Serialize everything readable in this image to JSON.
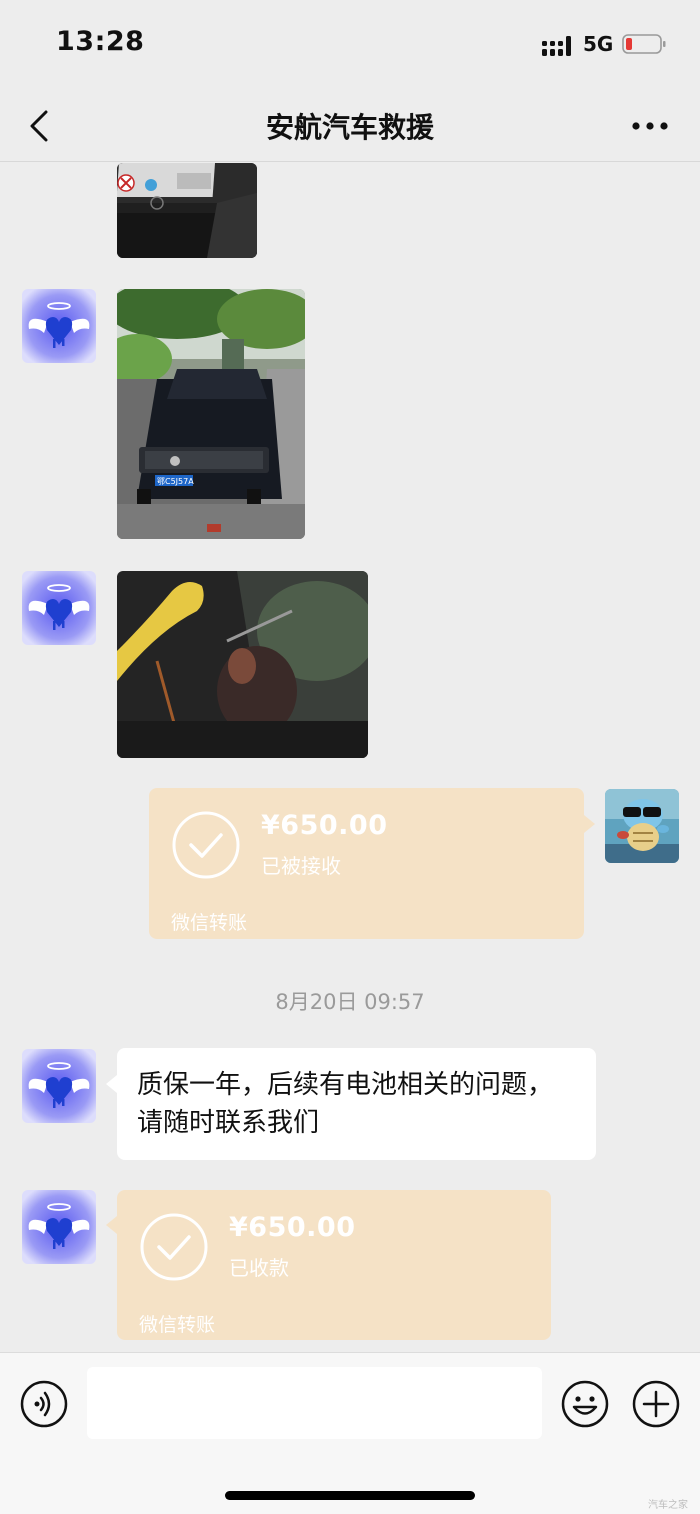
{
  "status_bar": {
    "time": "13:28",
    "network": "5G"
  },
  "header": {
    "title": "安航汽车救援"
  },
  "messages": {
    "transfer_sent": {
      "amount": "¥650.00",
      "status": "已被接收",
      "label": "微信转账"
    },
    "timestamp": "8月20日 09:57",
    "text": "质保一年，后续有电池相关的问题，请随时联系我们",
    "transfer_received": {
      "amount": "¥650.00",
      "status": "已收款",
      "label": "微信转账"
    }
  },
  "plate_text": "鄂C5J57A",
  "watermark": "汽车之家",
  "colors": {
    "transfer_bg": "#f5e2c6",
    "bg": "#ededed",
    "battery_low": "#e53935"
  }
}
